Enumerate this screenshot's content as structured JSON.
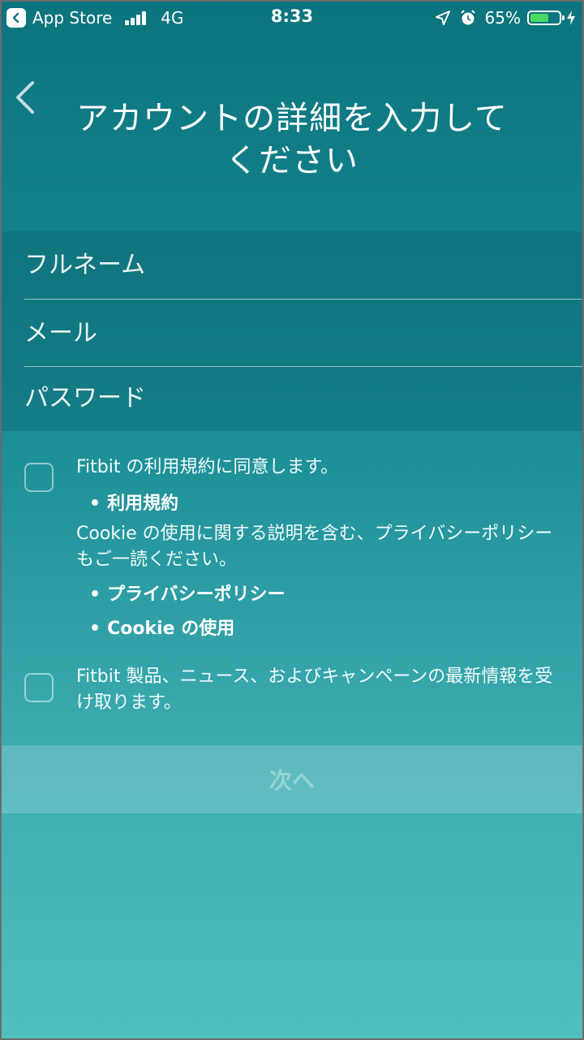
{
  "status_bar": {
    "back_app": "App Store",
    "network": "4G",
    "time": "8:33",
    "battery": "65%",
    "battery_level": 0.65,
    "battery_color": "#4cd964"
  },
  "header": {
    "title": "アカウントの詳細を入力してください"
  },
  "form": {
    "fullname_placeholder": "フルネーム",
    "email_placeholder": "メール",
    "password_placeholder": "パスワード"
  },
  "consent": {
    "terms_text": "Fitbit の利用規約に同意します。",
    "terms_link": "利用規約",
    "privacy_text": "Cookie の使用に関する説明を含む、プライバシーポリシーもご一読ください。",
    "privacy_link": "プライバシーポリシー",
    "cookie_link": "Cookie の使用",
    "news_text": "Fitbit 製品、ニュース、およびキャンペーンの最新情報を受け取ります。"
  },
  "actions": {
    "next_label": "次へ"
  },
  "colors": {
    "background_top": "#0b747d",
    "background_bottom": "#4fc0bd"
  },
  "icons": [
    "back-app-icon",
    "signal-icon",
    "location-icon",
    "alarm-icon",
    "battery-icon",
    "charging-icon",
    "back-chevron-icon"
  ]
}
